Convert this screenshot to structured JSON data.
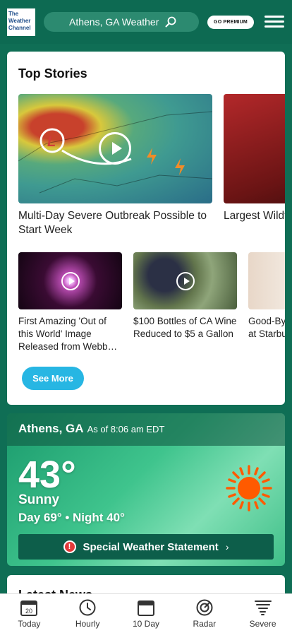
{
  "header": {
    "logo_lines": [
      "The",
      "Weather",
      "Channel"
    ],
    "location_label": "Athens, GA Weather",
    "premium_label": "GO PREMIUM"
  },
  "top_stories": {
    "heading": "Top Stories",
    "featured": [
      {
        "caption": "Multi-Day Severe Outbreak Possible to Start Week",
        "has_video": true
      },
      {
        "caption": "Largest Wildfire Continues to Grow",
        "has_video": false
      }
    ],
    "secondary": [
      {
        "caption": "First Amazing 'Out of this World' Image Released from Webb…",
        "has_video": true
      },
      {
        "caption": "$100 Bottles of CA Wine Reduced to $5 a Gallon",
        "has_video": true
      },
      {
        "caption": "Good-Bye Plastic Cups at Starbucks",
        "has_video": false
      }
    ],
    "see_more": "See More"
  },
  "current": {
    "city": "Athens, GA",
    "as_of": "As of 8:06 am EDT",
    "temperature": "43°",
    "condition": "Sunny",
    "day_night": "Day 69° • Night 40°",
    "alert": "Special Weather Statement",
    "icon": "sun-icon"
  },
  "latest_news": {
    "heading": "Latest News"
  },
  "nav": [
    {
      "label": "Today",
      "icon": "calendar-today-icon",
      "date": "20"
    },
    {
      "label": "Hourly",
      "icon": "clock-icon"
    },
    {
      "label": "10 Day",
      "icon": "calendar-icon"
    },
    {
      "label": "Radar",
      "icon": "radar-icon"
    },
    {
      "label": "Severe",
      "icon": "tornado-icon"
    }
  ]
}
